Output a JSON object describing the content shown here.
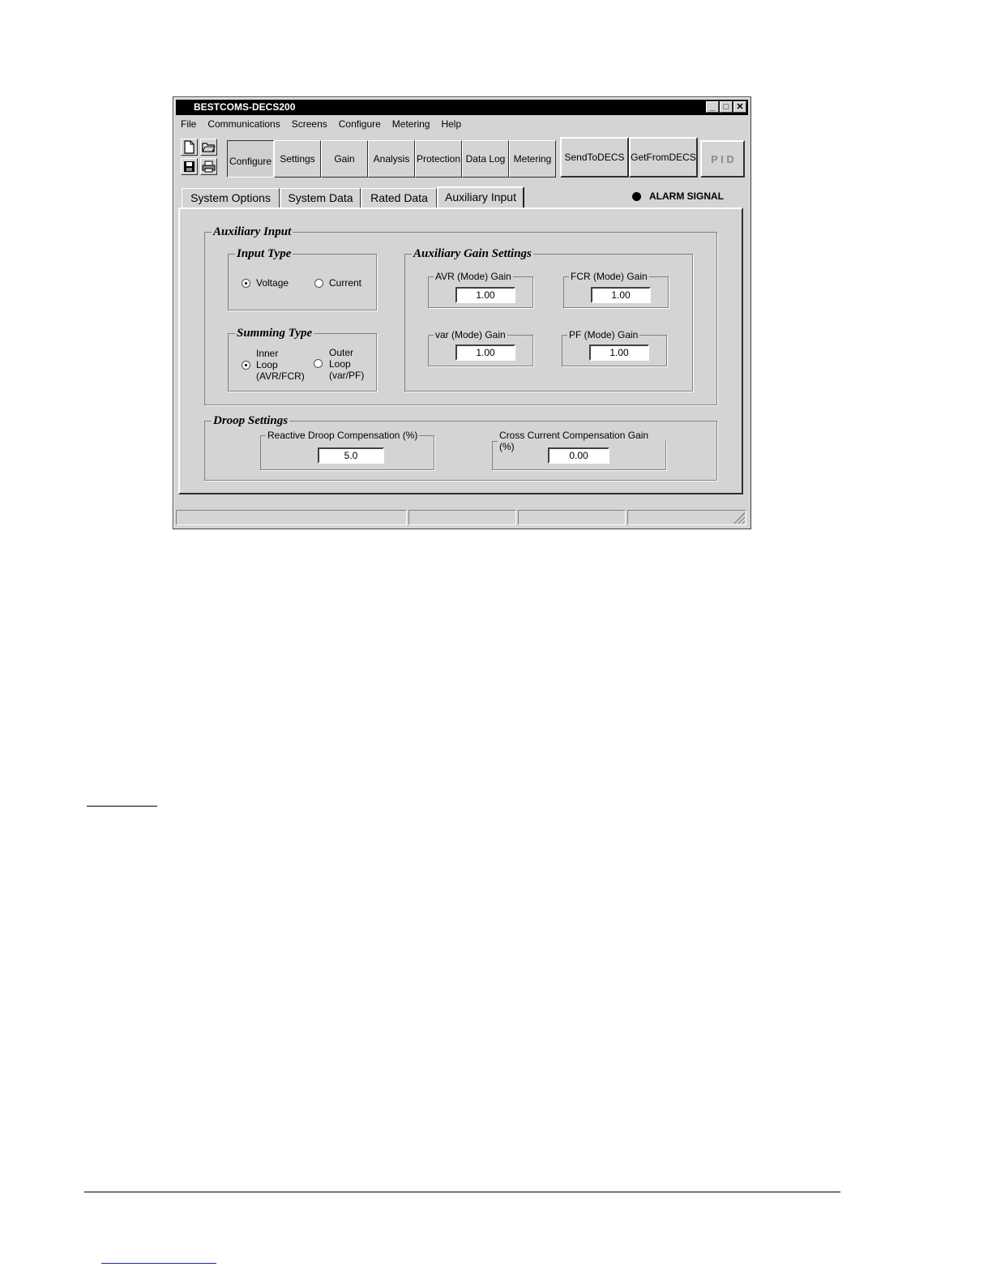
{
  "window": {
    "title": "BESTCOMS-DECS200",
    "controls": {
      "minimize": "_",
      "maximize": "□",
      "close": "✕"
    }
  },
  "menu": [
    "File",
    "Communications",
    "Screens",
    "Configure",
    "Metering",
    "Help"
  ],
  "file_icons": [
    "new-file-icon",
    "open-folder-icon",
    "save-icon",
    "print-icon"
  ],
  "toolbar": {
    "buttons": [
      "Configure",
      "Settings",
      "Gain",
      "Analysis",
      "Protection",
      "Data Log",
      "Metering"
    ],
    "send": "SendToDECS",
    "get": "GetFromDECS",
    "pid": "P I D"
  },
  "tabs": [
    "System Options",
    "System Data",
    "Rated Data",
    "Auxiliary Input"
  ],
  "active_tab": "Auxiliary Input",
  "alarm": "ALARM SIGNAL",
  "aux_input": {
    "title": "Auxiliary Input",
    "input_type": {
      "title": "Input Type",
      "voltage": "Voltage",
      "current": "Current",
      "selected": "Voltage"
    },
    "summing_type": {
      "title": "Summing Type",
      "inner": [
        "Inner",
        "Loop",
        "(AVR/FCR)"
      ],
      "outer": [
        "Outer",
        "Loop",
        "(var/PF)"
      ],
      "selected": "Inner Loop (AVR/FCR)"
    },
    "gain_settings": {
      "title": "Auxiliary Gain Settings",
      "avr": {
        "label": "AVR (Mode) Gain",
        "value": "1.00"
      },
      "fcr": {
        "label": "FCR (Mode) Gain",
        "value": "1.00"
      },
      "var": {
        "label": "var (Mode) Gain",
        "value": "1.00"
      },
      "pf": {
        "label": "PF (Mode) Gain",
        "value": "1.00"
      }
    }
  },
  "droop": {
    "title": "Droop Settings",
    "reactive": {
      "label": "Reactive Droop Compensation (%)",
      "value": "5.0"
    },
    "cross": {
      "label": "Cross Current Compensation Gain (%)",
      "value": "0.00"
    }
  }
}
